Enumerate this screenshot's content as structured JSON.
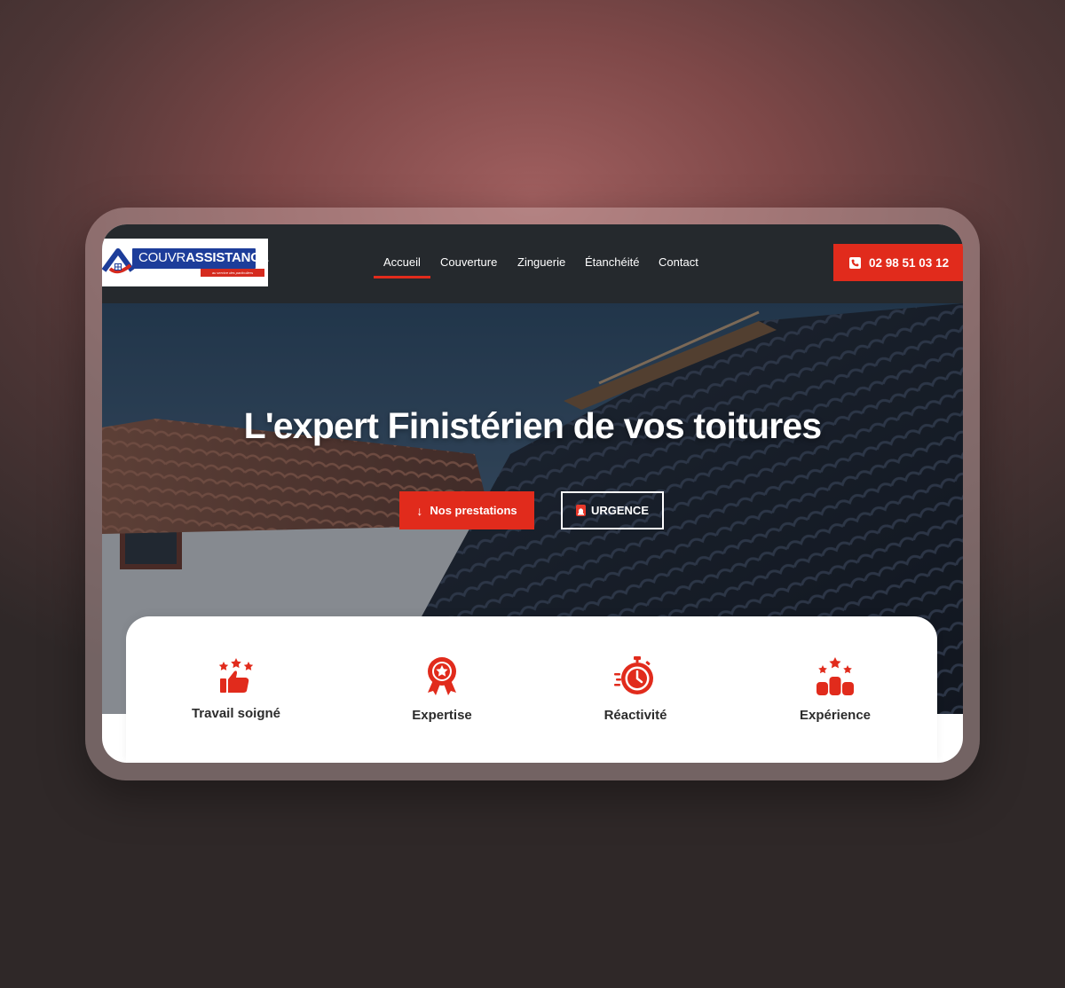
{
  "brand": {
    "logo_prefix": "COUVR",
    "logo_bold": "ASSISTANCE",
    "tagline": "au service des particuliers",
    "accent_color": "#e12b1c",
    "nav_bg": "#25292d"
  },
  "nav": {
    "items": [
      {
        "label": "Accueil",
        "active": true
      },
      {
        "label": "Couverture",
        "active": false
      },
      {
        "label": "Zinguerie",
        "active": false
      },
      {
        "label": "Étanchéité",
        "active": false
      },
      {
        "label": "Contact",
        "active": false
      }
    ],
    "phone": "02 98 51 03 12",
    "phone_icon": "phone-icon"
  },
  "hero": {
    "title": "L'expert Finistérien de vos toitures",
    "primary_button": "Nos prestations",
    "primary_icon": "arrow-down-icon",
    "secondary_button": "URGENCE",
    "secondary_icon": "siren-icon"
  },
  "features": [
    {
      "label": "Travail soigné",
      "icon": "thumbs-up-stars-icon"
    },
    {
      "label": "Expertise",
      "icon": "award-badge-icon"
    },
    {
      "label": "Réactivité",
      "icon": "stopwatch-icon"
    },
    {
      "label": "Expérience",
      "icon": "podium-stars-icon"
    }
  ]
}
